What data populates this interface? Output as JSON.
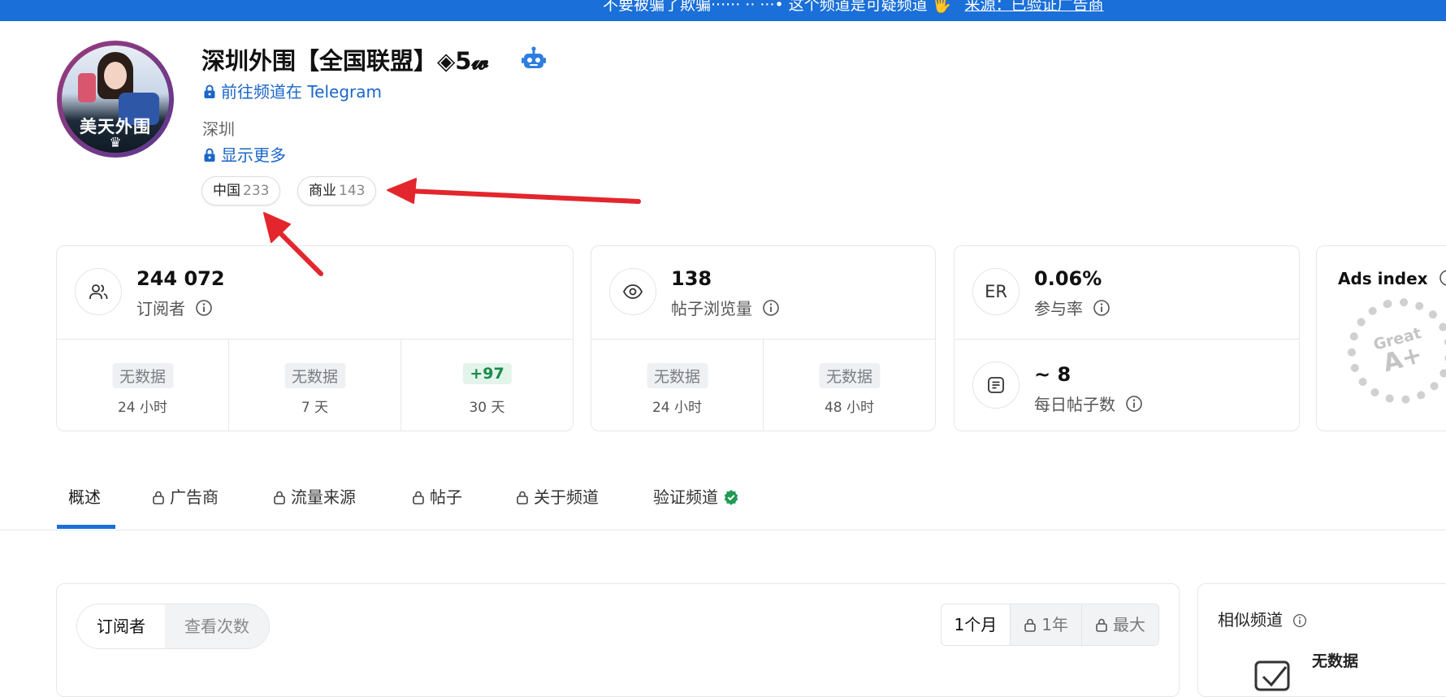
{
  "banner": {
    "text": "不要被骗了欺骗······ ·· ···• 这个频道是可疑频道 🖐",
    "link": "来源：已验证广告商"
  },
  "channel": {
    "title": "深圳外围【全国联盟】◈5𝔀",
    "avatar_text": "美天外围",
    "avatar_crown": "♛",
    "telegram_link": "前往频道在 Telegram",
    "location": "深圳",
    "show_more": "显示更多"
  },
  "tags": [
    {
      "label": "中国",
      "count": "233"
    },
    {
      "label": "商业",
      "count": "143"
    }
  ],
  "stats": {
    "subscribers": {
      "value": "244 072",
      "label": "订阅者",
      "periods": [
        {
          "value": "无数据",
          "period": "24 小时"
        },
        {
          "value": "无数据",
          "period": "7 天"
        },
        {
          "value": "+97",
          "period": "30 天"
        }
      ]
    },
    "views": {
      "value": "138",
      "label": "帖子浏览量",
      "periods": [
        {
          "value": "无数据",
          "period": "24 小时"
        },
        {
          "value": "无数据",
          "period": "48 小时"
        }
      ]
    },
    "er": {
      "icon_text": "ER",
      "value": "0.06%",
      "label": "参与率"
    },
    "daily_posts": {
      "value": "~ 8",
      "label": "每日帖子数"
    },
    "ads": {
      "title": "Ads index",
      "grade_word": "Great",
      "grade": "A+"
    }
  },
  "tabs": [
    {
      "label": "概述",
      "locked": false,
      "active": true
    },
    {
      "label": "广告商",
      "locked": true
    },
    {
      "label": "流量来源",
      "locked": true
    },
    {
      "label": "帖子",
      "locked": true
    },
    {
      "label": "关于频道",
      "locked": true
    },
    {
      "label": "验证频道",
      "locked": false,
      "verified": true
    }
  ],
  "chart_panel": {
    "toggle": [
      "订阅者",
      "查看次数"
    ],
    "ranges": [
      "1个月",
      "1年",
      "最大"
    ]
  },
  "similar": {
    "title": "相似频道",
    "nodata": "无数据"
  },
  "colors": {
    "accent": "#1a6fd8",
    "link": "#1a66c9",
    "positive": "#1a8a4a",
    "annotation_arrow": "#e3262d"
  }
}
